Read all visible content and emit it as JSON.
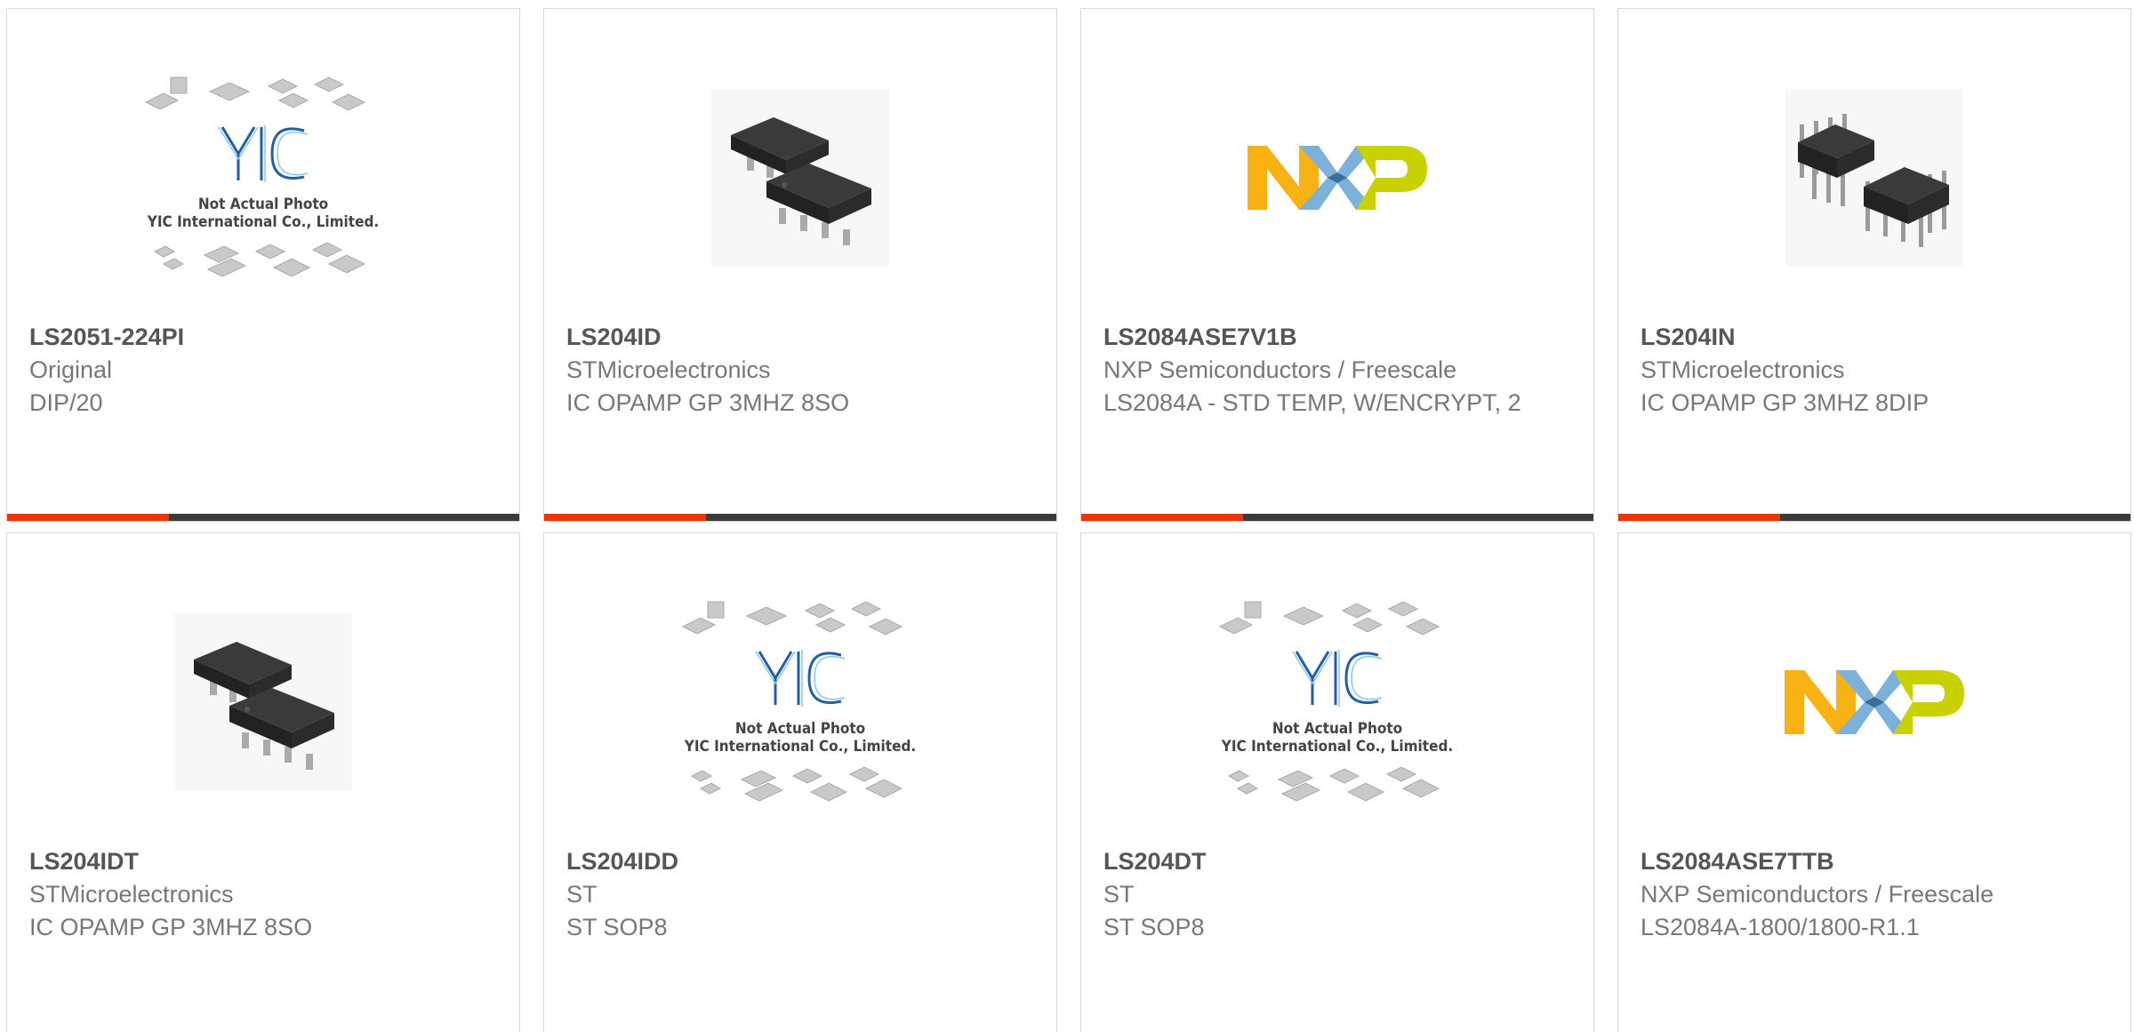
{
  "products": [
    {
      "part_number": "LS2051-224PI",
      "manufacturer": "Original",
      "description": "DIP/20",
      "image": "yic-placeholder",
      "placeholder_line1": "Not Actual Photo",
      "placeholder_line2": "YIC International Co., Limited."
    },
    {
      "part_number": "LS204ID",
      "manufacturer": "STMicroelectronics",
      "description": "IC OPAMP GP 3MHZ 8SO",
      "image": "so8-chip"
    },
    {
      "part_number": "LS2084ASE7V1B",
      "manufacturer": "NXP Semiconductors / Freescale",
      "description": "LS2084A - STD TEMP, W/ENCRYPT, 2",
      "image": "nxp-logo"
    },
    {
      "part_number": "LS204IN",
      "manufacturer": "STMicroelectronics",
      "description": "IC OPAMP GP 3MHZ 8DIP",
      "image": "dip8-chip"
    },
    {
      "part_number": "LS204IDT",
      "manufacturer": "STMicroelectronics",
      "description": "IC OPAMP GP 3MHZ 8SO",
      "image": "so8-chip"
    },
    {
      "part_number": "LS204IDD",
      "manufacturer": "ST",
      "description": "ST SOP8",
      "image": "yic-placeholder",
      "placeholder_line1": "Not Actual Photo",
      "placeholder_line2": "YIC International Co., Limited."
    },
    {
      "part_number": "LS204DT",
      "manufacturer": "ST",
      "description": "ST SOP8",
      "image": "yic-placeholder",
      "placeholder_line1": "Not Actual Photo",
      "placeholder_line2": "YIC International Co., Limited."
    },
    {
      "part_number": "LS2084ASE7TTB",
      "manufacturer": "NXP Semiconductors / Freescale",
      "description": "LS2084A-1800/1800-R1.1",
      "image": "nxp-logo"
    }
  ],
  "colors": {
    "accent": "#e8360e",
    "bar": "#3b3b3b",
    "nxp_orange": "#f9b214",
    "nxp_blue": "#7bb1db",
    "nxp_green": "#c9d200"
  }
}
